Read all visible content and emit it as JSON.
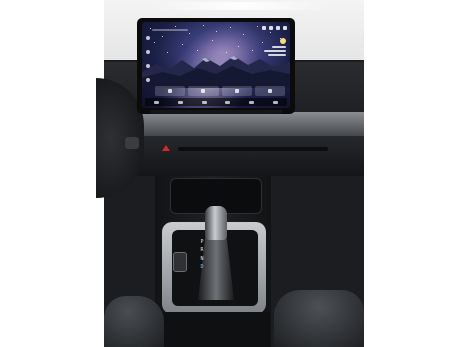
{
  "photo": {
    "subject": "car-interior-dashboard-and-center-console"
  },
  "display": {
    "wallpaper": "mountain-night-sky",
    "quick_tiles": [
      "tile-1",
      "tile-2",
      "tile-3",
      "tile-4"
    ],
    "gear_positions": [
      "P",
      "R",
      "N",
      "D"
    ],
    "active_gear": "D"
  },
  "colors": {
    "hazard": "#d22a2a",
    "gear_active": "#6fd0ff"
  }
}
